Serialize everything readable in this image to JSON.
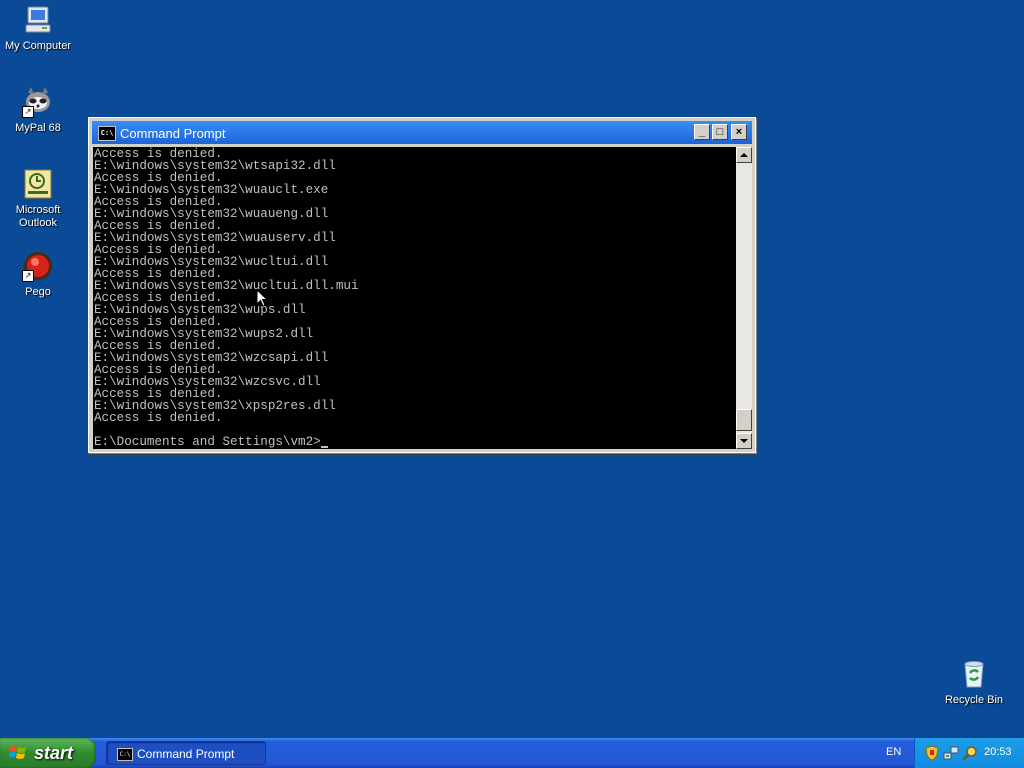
{
  "desktop": {
    "icons": [
      {
        "label": "My Computer",
        "icon": "my-computer-icon"
      },
      {
        "label": "MyPal 68",
        "icon": "mypal-icon"
      },
      {
        "label": "Microsoft Outlook",
        "icon": "outlook-icon"
      },
      {
        "label": "Pego",
        "icon": "pego-icon"
      },
      {
        "label": "Recycle Bin",
        "icon": "recycle-bin-icon"
      }
    ]
  },
  "window": {
    "title": "Command Prompt",
    "icon_text": "C:\\",
    "minimize": "_",
    "maximize": "□",
    "close": "×",
    "lines": [
      "Access is denied.",
      "E:\\windows\\system32\\wtsapi32.dll",
      "Access is denied.",
      "E:\\windows\\system32\\wuauclt.exe",
      "Access is denied.",
      "E:\\windows\\system32\\wuaueng.dll",
      "Access is denied.",
      "E:\\windows\\system32\\wuauserv.dll",
      "Access is denied.",
      "E:\\windows\\system32\\wucltui.dll",
      "Access is denied.",
      "E:\\windows\\system32\\wucltui.dll.mui",
      "Access is denied.",
      "E:\\windows\\system32\\wups.dll",
      "Access is denied.",
      "E:\\windows\\system32\\wups2.dll",
      "Access is denied.",
      "E:\\windows\\system32\\wzcsapi.dll",
      "Access is denied.",
      "E:\\windows\\system32\\wzcsvc.dll",
      "Access is denied.",
      "E:\\windows\\system32\\xpsp2res.dll",
      "Access is denied.",
      ""
    ],
    "prompt": "E:\\Documents and Settings\\vm2>"
  },
  "taskbar": {
    "start_label": "start",
    "task_label": "Command Prompt",
    "language": "EN",
    "clock": "20:53"
  },
  "colors": {
    "desktop": "#0a4a96",
    "console_bg": "#000000",
    "console_fg": "#c0c0c0"
  }
}
